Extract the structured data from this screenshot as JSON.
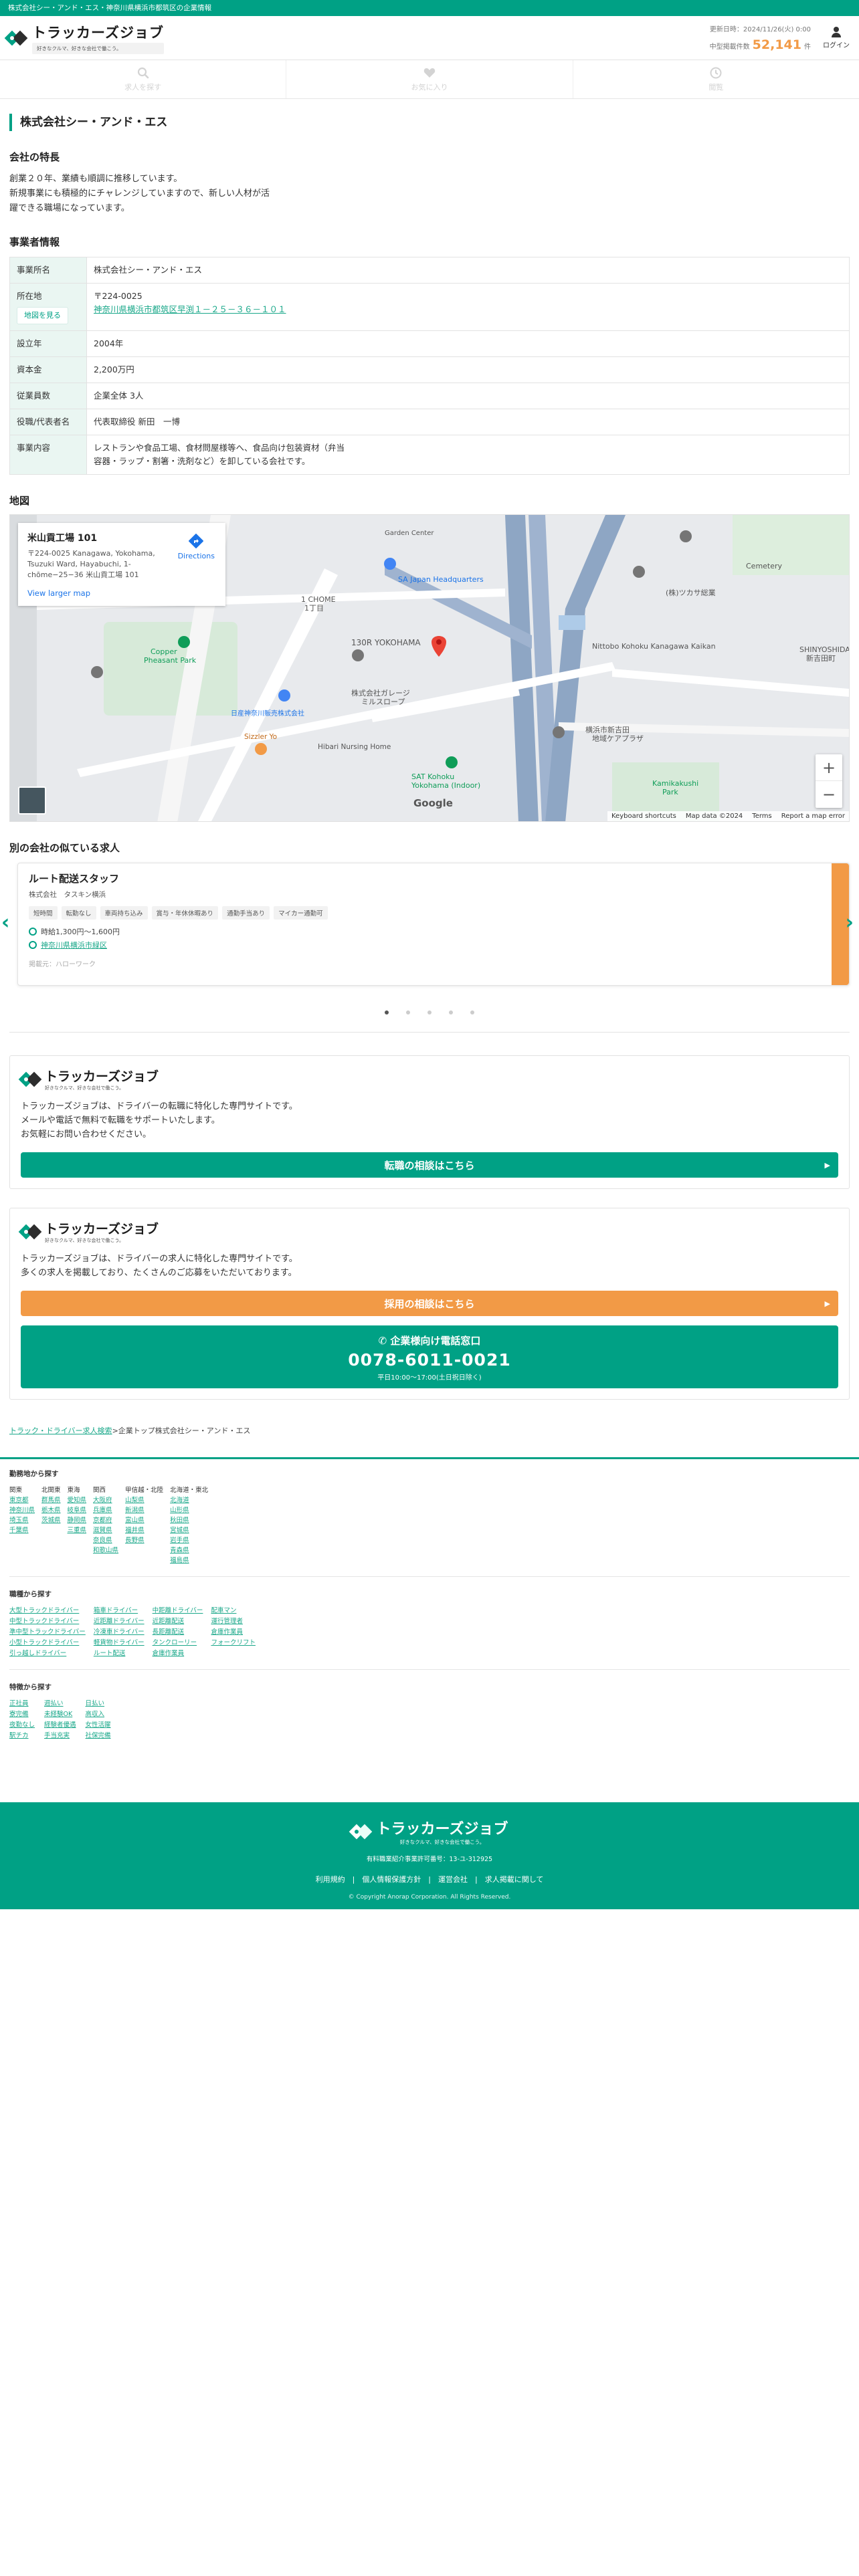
{
  "topbar": {
    "text": "株式会社シー・アンド・エス・神奈川県横浜市都筑区の企業情報"
  },
  "header": {
    "logo_name": "トラッカーズジョブ",
    "logo_tagline": "好きなクルマ、好きな会社で働こう。",
    "updated": "更新日時：2024/11/26(火) 0:00",
    "listing_label": "中型掲載件数",
    "listing_count": "52,141",
    "listing_unit": "件",
    "login_label": "ログイン"
  },
  "nav": {
    "search": "求人を探す",
    "favorites": "お気に入り",
    "history": "閲覧"
  },
  "company": {
    "title": "株式会社シー・アンド・エス",
    "features_heading": "会社の特長",
    "features": [
      "創業２０年、業績も順調に推移しています。",
      "新規事業にも積極的にチャレンジしていますので、新しい人材が活",
      "躍できる職場になっています。"
    ],
    "info_heading": "事業者情報",
    "info": {
      "name_label": "事業所名",
      "name": "株式会社シー・アンド・エス",
      "address_label": "所在地",
      "map_button": "地図を見る",
      "zip": "〒224-0025",
      "address": "神奈川県横浜市都筑区早渕１－２５－３６－１０１",
      "founded_label": "設立年",
      "founded": "2004年",
      "capital_label": "資本金",
      "capital": "2,200万円",
      "employees_label": "従業員数",
      "employees": "企業全体 3人",
      "rep_label": "役職/代表者名",
      "rep": "代表取締役 新田　一博",
      "business_label": "事業内容",
      "business": [
        "レストランや食品工場、食材問屋様等へ、食品向け包装資材（弁当",
        "容器・ラップ・割箸・洗剤など）を卸している会社です。"
      ]
    }
  },
  "map": {
    "heading": "地図",
    "place": "米山貢工場 101",
    "address": "〒224-0025 Kanagawa, Yokohama, Tsuzuki Ward, Hayabuchi, 1-chōme−25−36 米山貢工場 101",
    "directions": "Directions",
    "larger": "View larger map",
    "google": "Google",
    "footer": [
      "Keyboard shortcuts",
      "Map data ©2024",
      "Terms",
      "Report a map error"
    ],
    "labels": [
      "1 CHOME",
      "1丁目",
      "130R YOKOHAMA",
      "株式会社ガレージ",
      "ミルスロープ",
      "SA Japan Headquarters",
      "(株)ツカサ総業",
      "SHINYOSHIDAC",
      "新吉田町",
      "横浜市新吉田",
      "地域ケアプラザ",
      "Hibari Nursing Home",
      "SAT Kohoku",
      "Yokohama (Indoor)",
      "Kamikakushi",
      "Park",
      "Copper",
      "Pheasant Park",
      "Cemetery",
      "Sizzler Yo",
      "日産神奈川販売株式会社",
      "Nittobo Kohoku Kanagawa Kaikan",
      "Garden Center"
    ]
  },
  "similar": {
    "heading": "別の会社の似ている求人",
    "job_title": "ルート配送スタッフ",
    "company": "株式会社　タスキン横浜",
    "tags": [
      "短時間",
      "転勤なし",
      "車両持ち込み",
      "賞与・年休休暇あり",
      "通勤手当あり",
      "マイカー通勤可"
    ],
    "salary": "時給1,300円〜1,600円",
    "location": "神奈川県横浜市緑区",
    "note": "掲載元：ハローワーク"
  },
  "promo1": {
    "logo_name": "トラッカーズジョブ",
    "logo_tagline": "好きなクルマ、好きな会社で働こう。",
    "lines": [
      "トラッカーズジョブは、ドライバーの転職に特化した専門サイトです。",
      "メールや電話で無料で転職をサポートいたします。",
      "お気軽にお問い合わせください。"
    ],
    "button": "転職の相談はこちら"
  },
  "promo2": {
    "logo_name": "トラッカーズジョブ",
    "logo_tagline": "好きなクルマ、好きな会社で働こう。",
    "lines": [
      "トラッカーズジョブは、ドライバーの求人に特化した専門サイトです。",
      "多くの求人を掲載しており、たくさんのご応募をいただいております。"
    ],
    "button": "採用の相談はこちら",
    "phone_label": "企業様向け電話窓口",
    "phone": "0078-6011-0021",
    "phone_hours": "平日10:00〜17:00(土日祝日除く)"
  },
  "breadcrumb": {
    "root": "トラック・ドライバー求人検索",
    "current": "企業トップ株式会社シー・アンド・エス"
  },
  "footer_links": {
    "region_heading": "勤務地から探す",
    "regions": [
      {
        "name": "関東",
        "items": [
          "東京都",
          "神奈川県",
          "埼玉県",
          "千葉県"
        ]
      },
      {
        "name": "北関東",
        "items": [
          "群馬県",
          "栃木県",
          "茨城県"
        ]
      },
      {
        "name": "東海",
        "items": [
          "愛知県",
          "岐阜県",
          "静岡県",
          "三重県"
        ]
      },
      {
        "name": "関西",
        "items": [
          "大阪府",
          "兵庫県",
          "京都府",
          "滋賀県",
          "奈良県",
          "和歌山県"
        ]
      },
      {
        "name": "甲信越・北陸",
        "items": [
          "山梨県",
          "新潟県",
          "富山県",
          "福井県",
          "長野県"
        ]
      },
      {
        "name": "北海道・東北",
        "items": [
          "北海道",
          "山形県",
          "秋田県",
          "宮城県",
          "岩手県",
          "青森県",
          "福島県"
        ]
      }
    ],
    "job_heading": "職種から探す",
    "jobs": [
      "大型トラックドライバー",
      "箱車ドライバー",
      "中距離ドライバー",
      "配車マン",
      "中型トラックドライバー",
      "近距離ドライバー",
      "近距離配送",
      "運行管理者",
      "準中型トラックドライバー",
      "冷凍車ドライバー",
      "長距離配送",
      "倉庫作業員",
      "小型トラックドライバー",
      "軽貨物ドライバー",
      "タンクローリー",
      "フォークリフト",
      "引っ越しドライバー",
      "ルート配送",
      "倉庫作業員"
    ],
    "feature_heading": "特徴から探す",
    "features": [
      "正社員",
      "週払い",
      "日払い",
      "寮完備",
      "未経験OK",
      "高収入",
      "夜勤なし",
      "経験者優遇",
      "女性活躍",
      "駅チカ",
      "手当充実",
      "社保完備"
    ]
  },
  "site_footer": {
    "logo_name": "トラッカーズジョブ",
    "logo_tagline": "好きなクルマ、好きな会社で働こう。",
    "license": "有料職業紹介事業許可番号：13-ユ-312925",
    "links": "利用規約　|　個人情報保護方針　|　運営会社　|　求人掲載に関して",
    "copyright": "© Copyright Anorap Corporation. All Rights Reserved."
  },
  "colors": {
    "brand": "#00a185",
    "accent": "#f29a46"
  }
}
